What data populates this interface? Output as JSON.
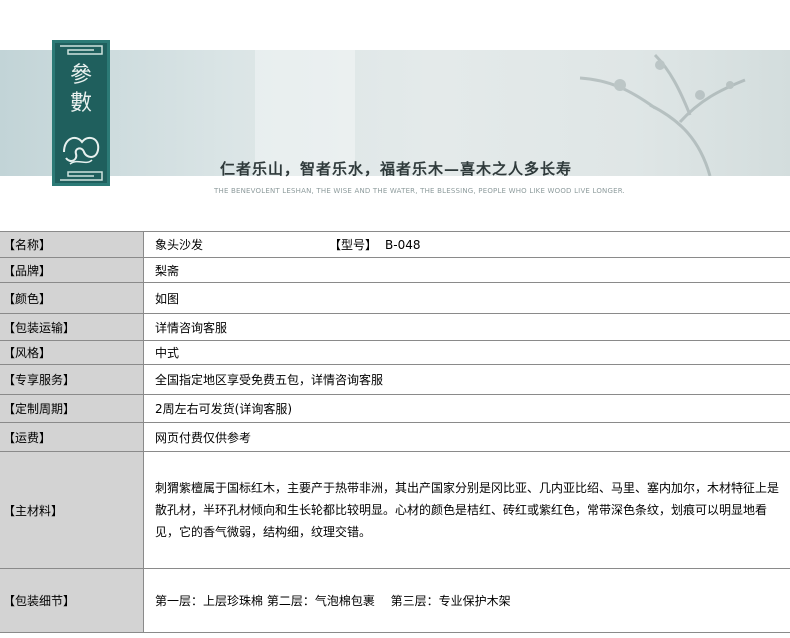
{
  "banner": {
    "seal_chars": [
      "參",
      "數"
    ],
    "slogan": "仁者乐山，智者乐水，福者乐木—喜木之人多长寿",
    "slogan_en": "THE BENEVOLENT LESHAN, THE WISE AND THE WATER, THE BLESSING, PEOPLE WHO LIKE WOOD LIVE LONGER."
  },
  "params": {
    "name_label": "【名称】",
    "name_value": "象头沙发",
    "model_label": "【型号】",
    "model_value": "B-048",
    "rows": [
      {
        "label": "【品牌】",
        "value": "梨斋"
      },
      {
        "label": "【颜色】",
        "value": "如图"
      },
      {
        "label": "【包装运输】",
        "value": "详情咨询客服"
      },
      {
        "label": "【风格】",
        "value": "中式"
      },
      {
        "label": "【专享服务】",
        "value": "全国指定地区享受免费五包，详情咨询客服"
      },
      {
        "label": "【定制周期】",
        "value": "2周左右可发货(详询客服)"
      },
      {
        "label": "【运费】",
        "value": "网页付费仅供参考"
      }
    ],
    "material_label": "【主材料】",
    "material_value": "刺猬紫檀属于国标红木，主要产于热带非洲，其出产国家分别是冈比亚、几内亚比绍、马里、塞内加尔，木材特征上是散孔材，半环孔材倾向和生长轮都比较明显。心材的颜色是桔红、砖红或紫红色，常带深色条纹，划痕可以明显地看见，它的香气微弱，结构细，纹理交错。",
    "packing_label": "【包装细节】",
    "packing_value": "第一层：上层珍珠棉 第二层：气泡棉包裹　 第三层：专业保护木架"
  }
}
